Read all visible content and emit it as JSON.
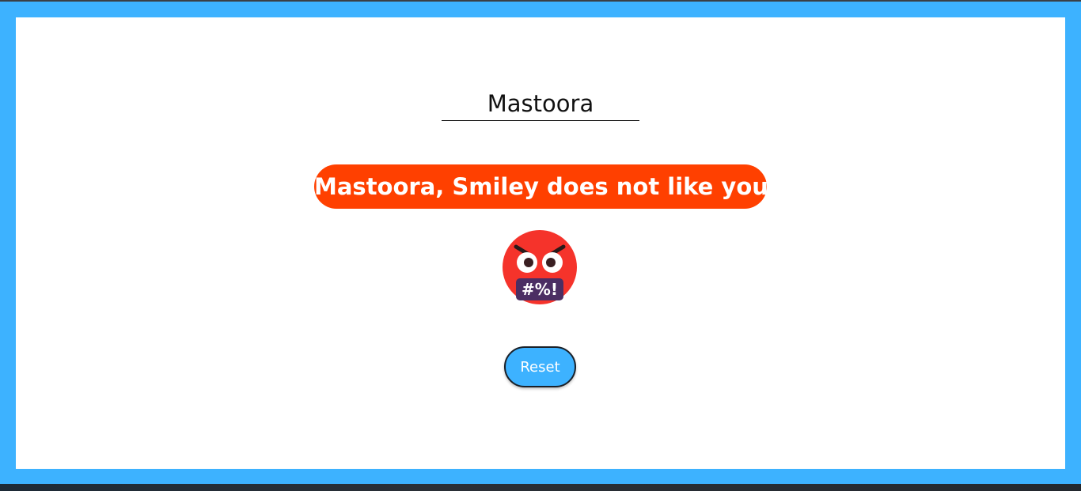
{
  "name_input": {
    "value": "Mastoora"
  },
  "message": {
    "text": "Mastoora, Smiley does not like you..",
    "background": "#ff4000"
  },
  "emoji": {
    "icon": "angry-face-with-symbols-icon",
    "symbols": "#%!"
  },
  "reset_button": {
    "label": "Reset",
    "background": "#3db2ff"
  },
  "colors": {
    "frame": "#3db2ff",
    "card": "#ffffff"
  }
}
